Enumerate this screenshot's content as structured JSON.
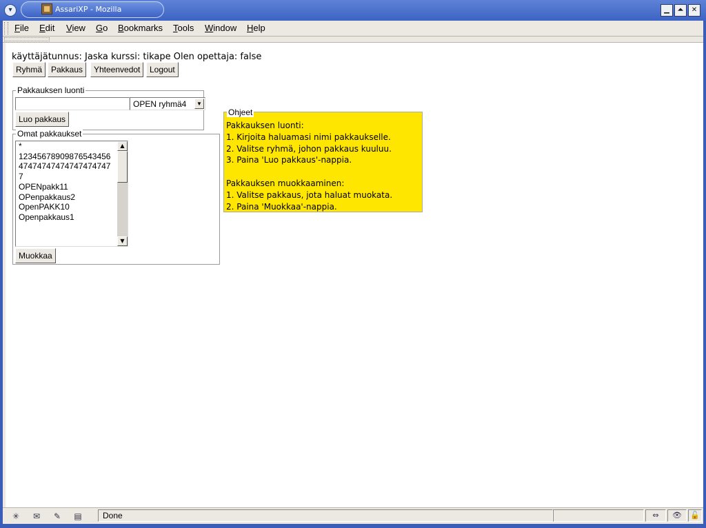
{
  "window": {
    "title": "AssariXP - Mozilla",
    "controls": {
      "minimize": "▁",
      "maximize": "⏶",
      "close": "✕"
    }
  },
  "menu": [
    "File",
    "Edit",
    "View",
    "Go",
    "Bookmarks",
    "Tools",
    "Window",
    "Help"
  ],
  "user_line": "käyttäjätunnus: Jaska kurssi: tikape Olen opettaja: false",
  "nav": [
    "Ryhmä",
    "Pakkaus",
    "Yhteenvedot",
    "Logout"
  ],
  "create": {
    "legend": "Pakkauksen luonti",
    "name_value": "",
    "group_selected": "OPEN ryhmä4",
    "create_button": "Luo pakkaus"
  },
  "own": {
    "legend": "Omat pakkaukset",
    "items": [
      "*",
      "12345678909876543456",
      "47474747474747474747",
      "7",
      "OPENpakk11",
      "OPenpakkaus2",
      "OpenPAKK10",
      "Openpakkaus1"
    ],
    "edit_button": "Muokkaa"
  },
  "help": {
    "legend": "Ohjeet",
    "lines": [
      "Pakkauksen luonti:",
      "1. Kirjoita haluamasi nimi pakkaukselle.",
      "2. Valitse ryhmä, johon pakkaus kuuluu.",
      "3. Paina 'Luo pakkaus'-nappia.",
      "",
      "Pakkauksen muokkaaminen:",
      "1. Valitse pakkaus, jota haluat muokata.",
      "2. Paina 'Muokkaa'-nappia."
    ],
    "background": "#ffe600"
  },
  "status": {
    "text": "Done",
    "icons": [
      "navigator-icon",
      "mail-icon",
      "composer-icon",
      "address-book-icon"
    ]
  }
}
